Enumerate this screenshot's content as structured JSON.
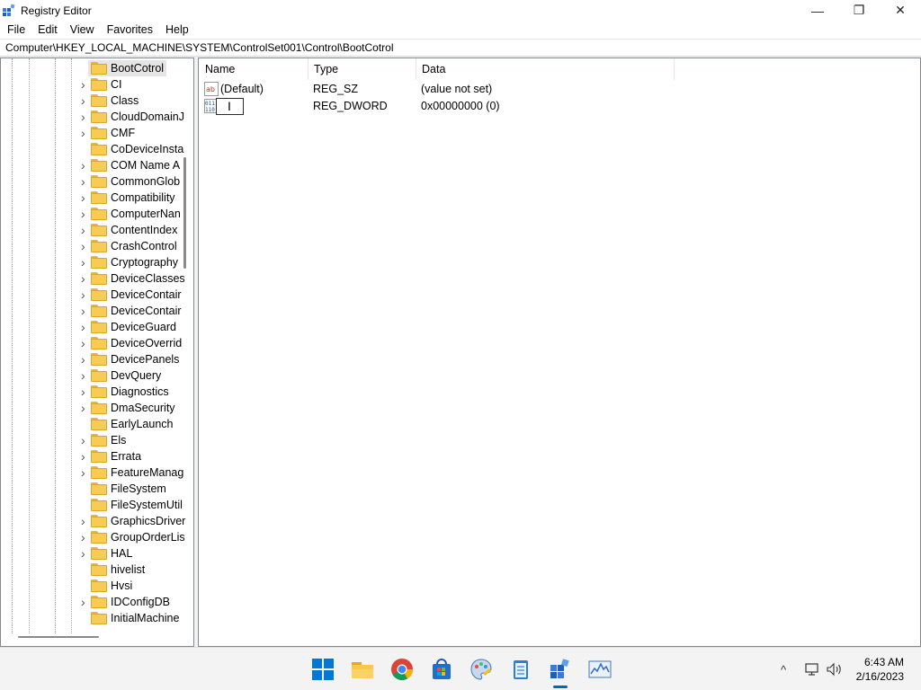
{
  "window": {
    "title": "Registry Editor",
    "minimize_glyph": "—",
    "maximize_glyph": "❐",
    "close_glyph": "✕"
  },
  "menu": [
    "File",
    "Edit",
    "View",
    "Favorites",
    "Help"
  ],
  "address": "Computer\\HKEY_LOCAL_MACHINE\\SYSTEM\\ControlSet001\\Control\\BootCotrol",
  "tree": {
    "selected": "BootCotrol",
    "items": [
      {
        "label": "BootCotrol",
        "expandable": false,
        "selected": true
      },
      {
        "label": "CI",
        "expandable": true
      },
      {
        "label": "Class",
        "expandable": true
      },
      {
        "label": "CloudDomainJ",
        "expandable": true
      },
      {
        "label": "CMF",
        "expandable": true
      },
      {
        "label": "CoDeviceInsta",
        "expandable": false
      },
      {
        "label": "COM Name A",
        "expandable": true
      },
      {
        "label": "CommonGlob",
        "expandable": true
      },
      {
        "label": "Compatibility",
        "expandable": true
      },
      {
        "label": "ComputerNan",
        "expandable": true
      },
      {
        "label": "ContentIndex",
        "expandable": true
      },
      {
        "label": "CrashControl",
        "expandable": true
      },
      {
        "label": "Cryptography",
        "expandable": true
      },
      {
        "label": "DeviceClasses",
        "expandable": true
      },
      {
        "label": "DeviceContair",
        "expandable": true
      },
      {
        "label": "DeviceContair",
        "expandable": true
      },
      {
        "label": "DeviceGuard",
        "expandable": true
      },
      {
        "label": "DeviceOverrid",
        "expandable": true
      },
      {
        "label": "DevicePanels",
        "expandable": true
      },
      {
        "label": "DevQuery",
        "expandable": true
      },
      {
        "label": "Diagnostics",
        "expandable": true
      },
      {
        "label": "DmaSecurity",
        "expandable": true
      },
      {
        "label": "EarlyLaunch",
        "expandable": false
      },
      {
        "label": "Els",
        "expandable": true
      },
      {
        "label": "Errata",
        "expandable": true
      },
      {
        "label": "FeatureManag",
        "expandable": true
      },
      {
        "label": "FileSystem",
        "expandable": false
      },
      {
        "label": "FileSystemUtil",
        "expandable": false
      },
      {
        "label": "GraphicsDriver",
        "expandable": true
      },
      {
        "label": "GroupOrderLis",
        "expandable": true
      },
      {
        "label": "HAL",
        "expandable": true
      },
      {
        "label": "hivelist",
        "expandable": false
      },
      {
        "label": "Hvsi",
        "expandable": false
      },
      {
        "label": "IDConfigDB",
        "expandable": true
      },
      {
        "label": "InitialMachine",
        "expandable": false
      }
    ]
  },
  "list": {
    "columns": [
      "Name",
      "Type",
      "Data"
    ],
    "rows": [
      {
        "icon": "string-value-icon",
        "name": "(Default)",
        "type": "REG_SZ",
        "data": "(value not set)"
      },
      {
        "icon": "dword-value-icon",
        "name": "",
        "type": "REG_DWORD",
        "data": "0x00000000 (0)",
        "renaming": true
      }
    ]
  },
  "taskbar": {
    "apps": [
      "start-icon",
      "file-explorer-icon",
      "chrome-icon",
      "microsoft-store-icon",
      "paint-icon",
      "notepad-icon",
      "registry-editor-icon",
      "performance-monitor-icon"
    ],
    "active_app": "registry-editor-icon",
    "tray_chevron": "^",
    "time": "6:43 AM",
    "date": "2/16/2023"
  },
  "colors": {
    "accent": "#0067c0",
    "folder": "#f7cc55",
    "selection": "#e5e5e5"
  }
}
